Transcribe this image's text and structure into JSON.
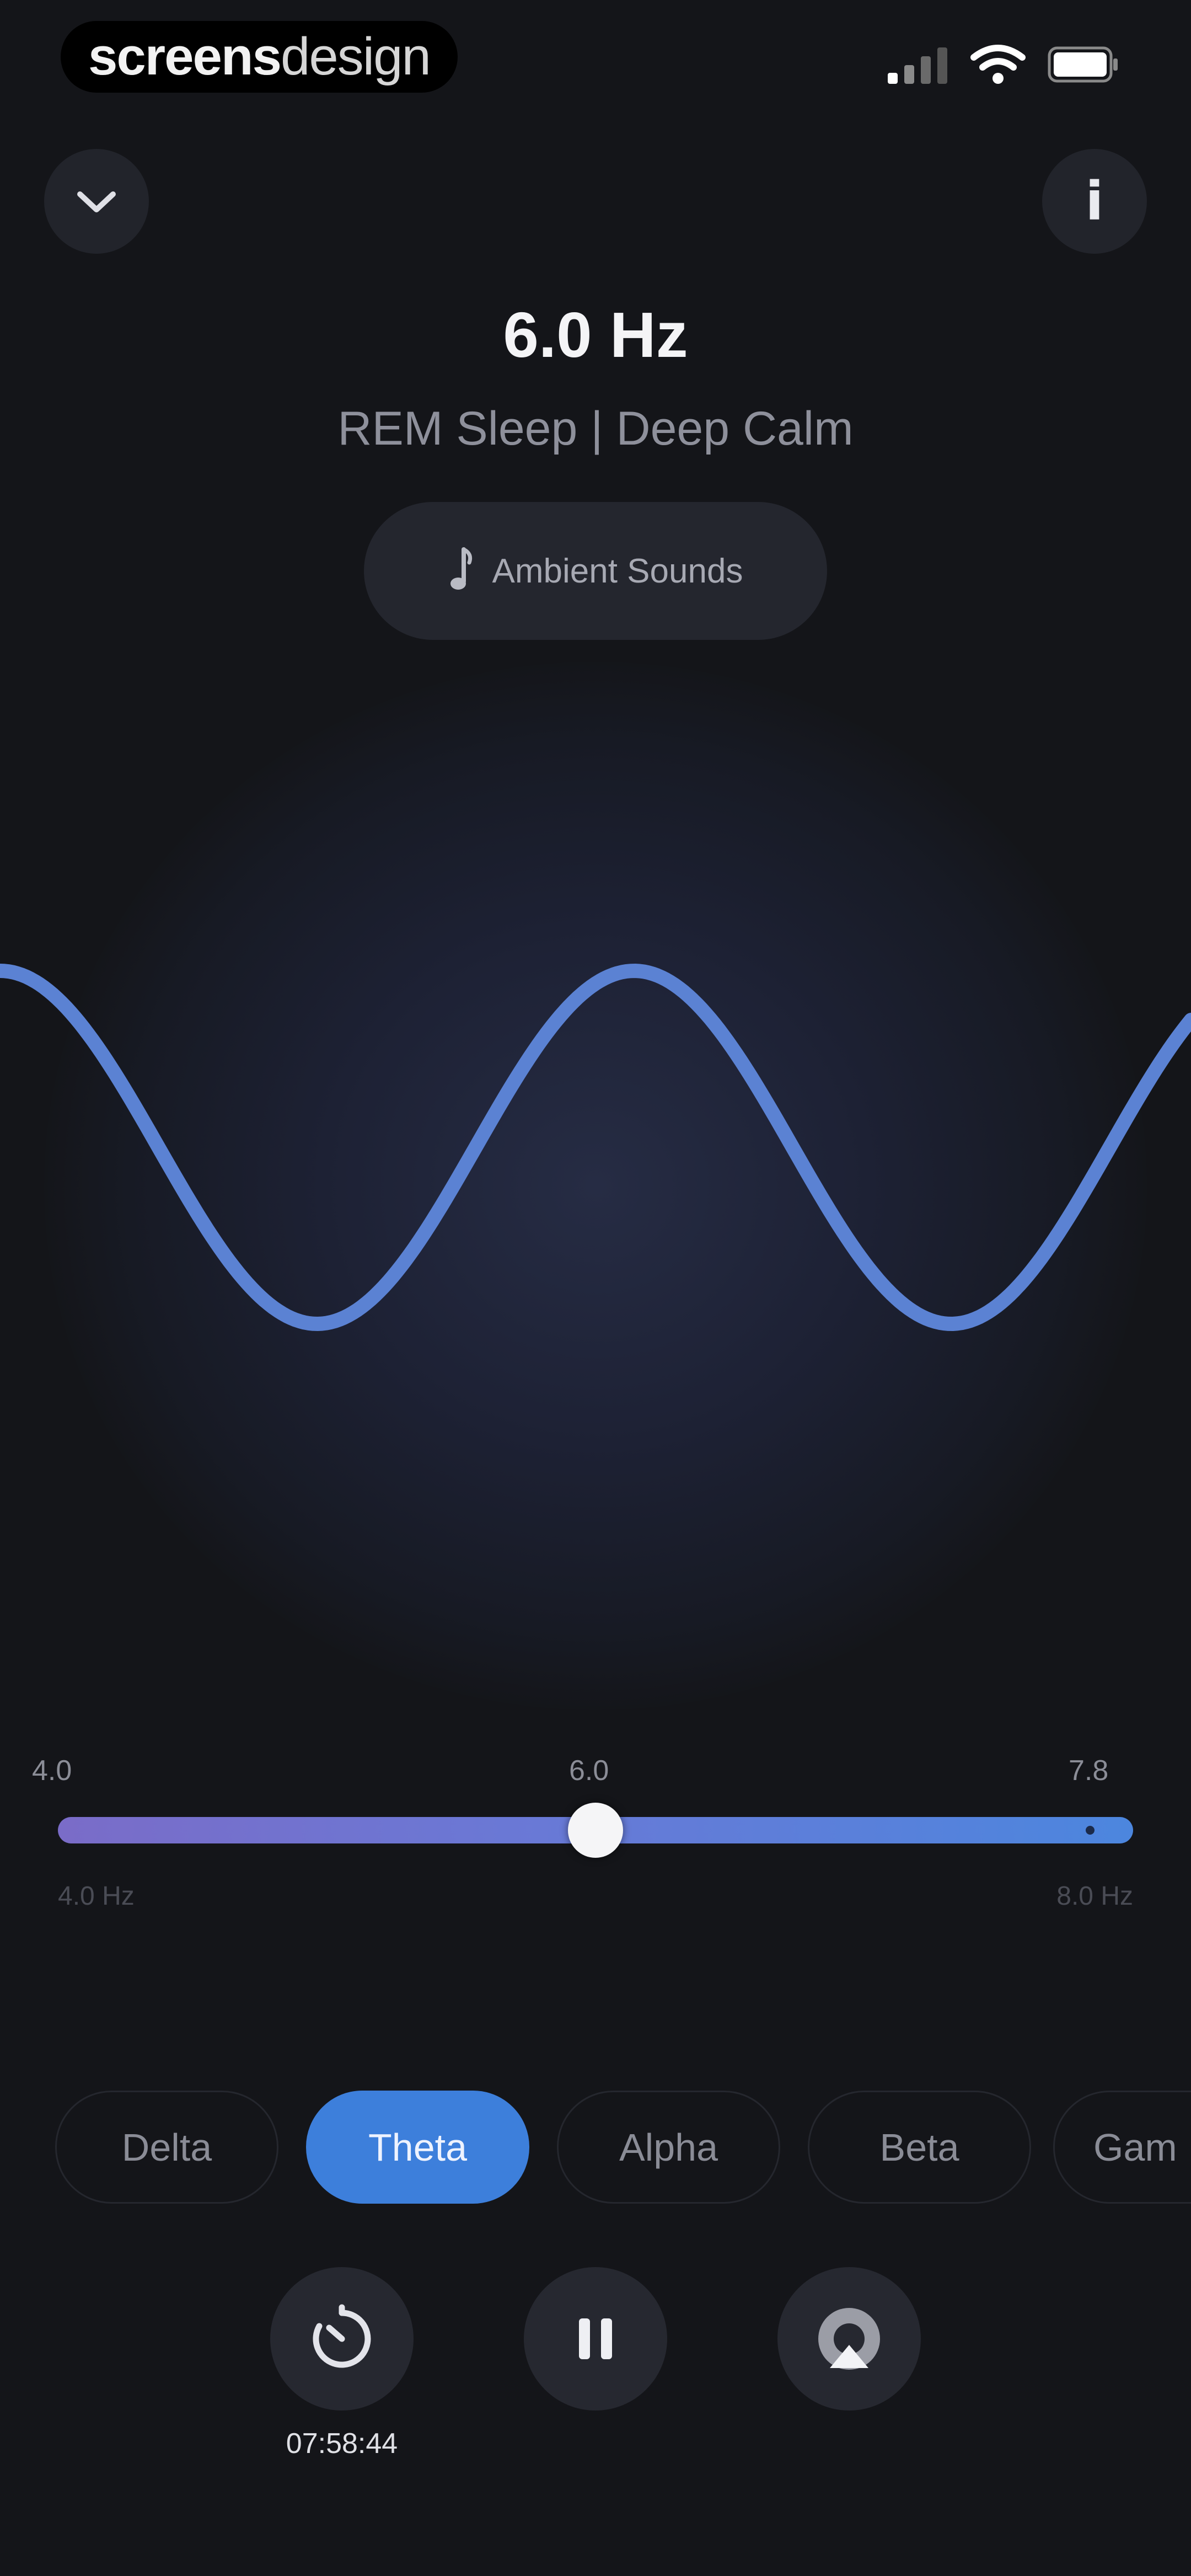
{
  "status_bar": {
    "watermark_bold": "screens",
    "watermark_light": "design",
    "icons": [
      "cellular-signal-icon",
      "wifi-icon",
      "battery-icon"
    ]
  },
  "header": {
    "collapse_icon": "chevron-down-icon",
    "info_icon": "info-icon",
    "info_glyph": "i",
    "frequency": "6.0 Hz",
    "state": "REM Sleep | Deep Calm",
    "ambient_button": {
      "icon": "music-note-icon",
      "label": "Ambient Sounds"
    }
  },
  "slider": {
    "min_tick": "4.0",
    "current_tick": "6.0",
    "max_tick": "7.8",
    "value": 6.0,
    "min": 4.0,
    "max": 7.8,
    "range_min_label": "4.0 Hz",
    "range_max_label": "8.0 Hz"
  },
  "bands": {
    "items": [
      {
        "label": "Delta",
        "selected": false
      },
      {
        "label": "Theta",
        "selected": true
      },
      {
        "label": "Alpha",
        "selected": false
      },
      {
        "label": "Beta",
        "selected": false
      },
      {
        "label": "Gam",
        "selected": false
      }
    ]
  },
  "controls": {
    "timer_icon": "timer-icon",
    "pause_icon": "pause-icon",
    "airplay_icon": "airplay-icon",
    "timer": "07:58:44"
  },
  "colors": {
    "accent": "#3d7fdb",
    "wave": "#5b82d3",
    "background": "#141519"
  }
}
